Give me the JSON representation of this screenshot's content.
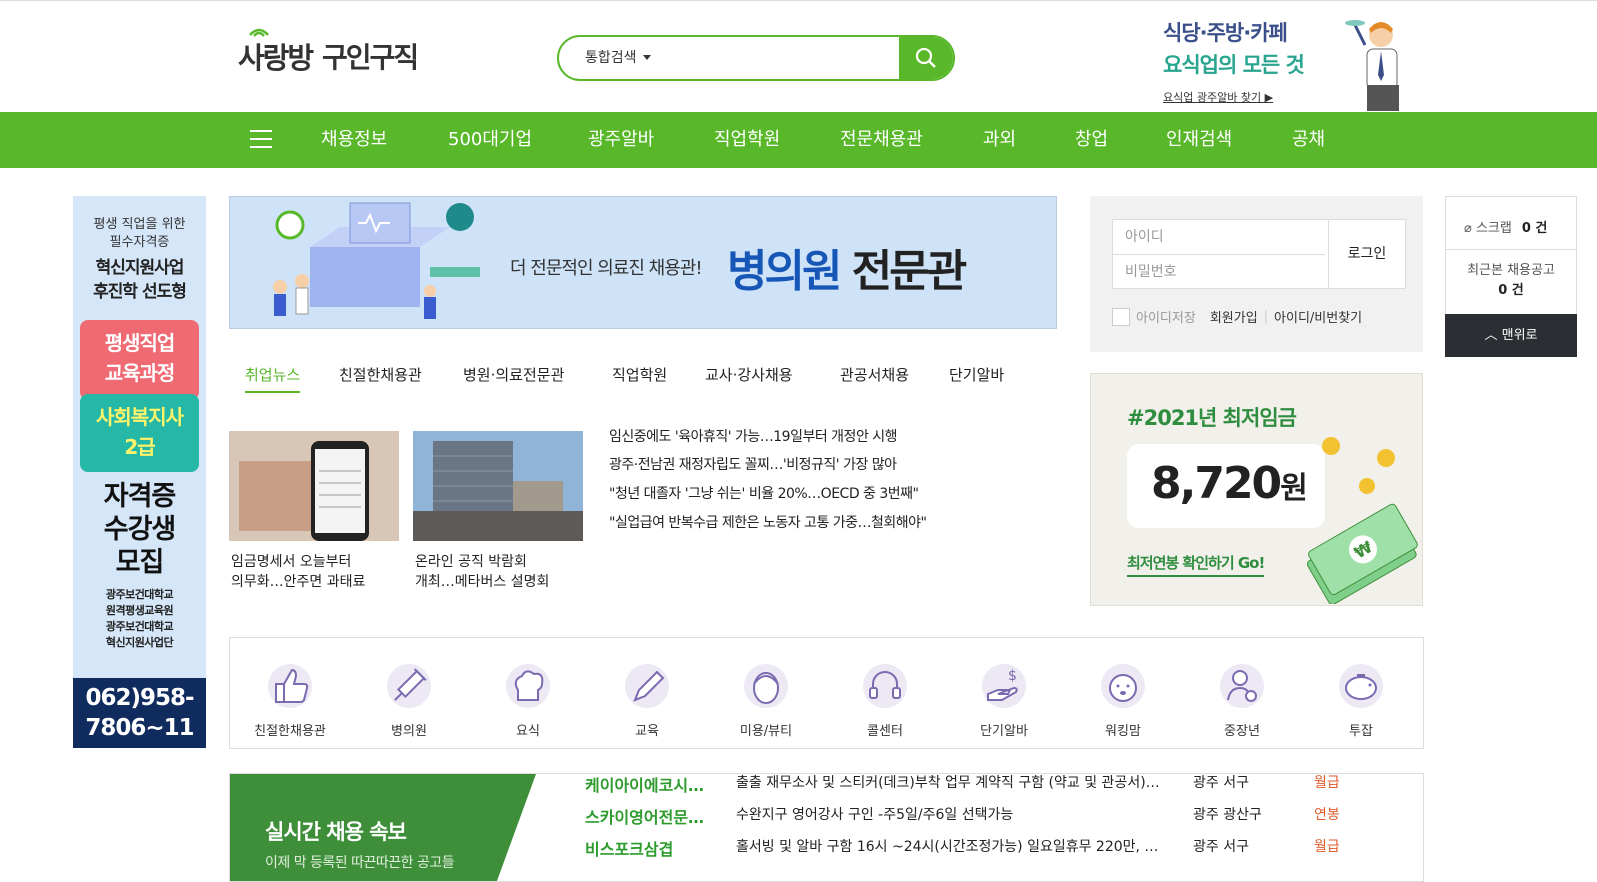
{
  "header": {
    "logo_main": "사랑방",
    "logo_sub": "구인구직",
    "search": {
      "scope": "통합검색",
      "placeholder": ""
    },
    "promo": {
      "line1": "식당·주방·카페",
      "line2": "요식업의 모든 것",
      "line3": "요식업 광주알바 찾기 ▶"
    }
  },
  "nav": {
    "items": [
      "채용정보",
      "500대기업",
      "광주알바",
      "직업학원",
      "전문채용관",
      "과외",
      "창업",
      "인재검색",
      "공채"
    ]
  },
  "side_ad": {
    "line1": "평생 직업을 위한",
    "line2": "필수자격증",
    "line3": "혁신지원사업",
    "line4": "후진학 선도형",
    "box1_a": "평생직업",
    "box1_b": "교육과정",
    "box2_a": "사회복지사",
    "box2_b": "2급",
    "big1": "자격증",
    "big2": "수강생",
    "big3": "모집",
    "inst1_a": "광주보건대학교",
    "inst1_b": "원격평생교육원",
    "inst2_a": "광주보건대학교",
    "inst2_b": "혁신지원사업단",
    "phone_a": "062)958-",
    "phone_b": "7806~11"
  },
  "banner": {
    "small": "더 전문적인 의료진 채용관!",
    "big_a": "병의원",
    "big_b": "전문관"
  },
  "tabs": [
    "취업뉴스",
    "친절한채용관",
    "병원·의료전문관",
    "직업학원",
    "교사·강사채용",
    "관공서채용",
    "단기알바"
  ],
  "news": {
    "cards": [
      {
        "caption1": "임금명세서 오늘부터",
        "caption2": "의무화…안주면 과태료"
      },
      {
        "caption1": "온라인 공직 박람회",
        "caption2": "개최…메타버스 설명회"
      }
    ],
    "headlines": [
      "임신중에도 '육아휴직' 가능…19일부터 개정안 시행",
      "광주·전남권 재정자립도 꼴찌…'비정규직' 가장 많아",
      "\"청년 대졸자 '그냥 쉬는' 비율 20%…OECD 중 3번째\"",
      "\"실업급여 반복수급 제한은 노동자 고통 가중…철회해야\""
    ]
  },
  "login": {
    "id_placeholder": "아이디",
    "pw_placeholder": "비밀번호",
    "login_button": "로그인",
    "remember": "아이디저장",
    "signup": "회원가입",
    "find": "아이디/비번찾기"
  },
  "wage_ad": {
    "heading": "#2021년 최저임금",
    "amount": "8,720",
    "unit": "원",
    "link": "최저연봉 확인하기 Go!"
  },
  "mini": {
    "scrap_label": "스크랩",
    "scrap_count": "0 건",
    "recent_label": "최근본 채용공고",
    "recent_count": "0 건",
    "top_button": "맨위로"
  },
  "categories": [
    {
      "label": "친절한채용관",
      "icon": "thumbs-up-icon"
    },
    {
      "label": "병의원",
      "icon": "syringe-icon"
    },
    {
      "label": "요식",
      "icon": "chef-hat-icon"
    },
    {
      "label": "교육",
      "icon": "pencil-icon"
    },
    {
      "label": "미용/뷰티",
      "icon": "face-icon"
    },
    {
      "label": "콜센터",
      "icon": "headset-icon"
    },
    {
      "label": "단기알바",
      "icon": "hand-money-icon"
    },
    {
      "label": "워킹맘",
      "icon": "baby-icon"
    },
    {
      "label": "중장년",
      "icon": "person-search-icon"
    },
    {
      "label": "투잡",
      "icon": "piggy-bank-icon"
    }
  ],
  "realtime": {
    "heading": "실시간 채용 속보",
    "sub": "이제 막 등록된 따끈따끈한 공고들",
    "rows": [
      {
        "company": "케이아이에코시…",
        "title": "출출 재무소사 및 스티커(데크)부착 업무 계약직 구함 (약교 및 관공서)…",
        "location": "광주 서구",
        "pay": "월급"
      },
      {
        "company": "스카이영어전문…",
        "title": "수완지구 영어강사 구인 -주5일/주6일 선택가능",
        "location": "광주 광산구",
        "pay": "연봉"
      },
      {
        "company": "비스포크삼겹",
        "title": "홀서빙 및 알바 구함 16시 ~24시(시간조정가능) 일요일휴무 220만, 시…",
        "location": "광주 서구",
        "pay": "월급"
      }
    ]
  },
  "colors": {
    "brand_green": "#58b82a",
    "dark_green": "#3f8f3a",
    "pay_orange": "#e25b2b"
  }
}
